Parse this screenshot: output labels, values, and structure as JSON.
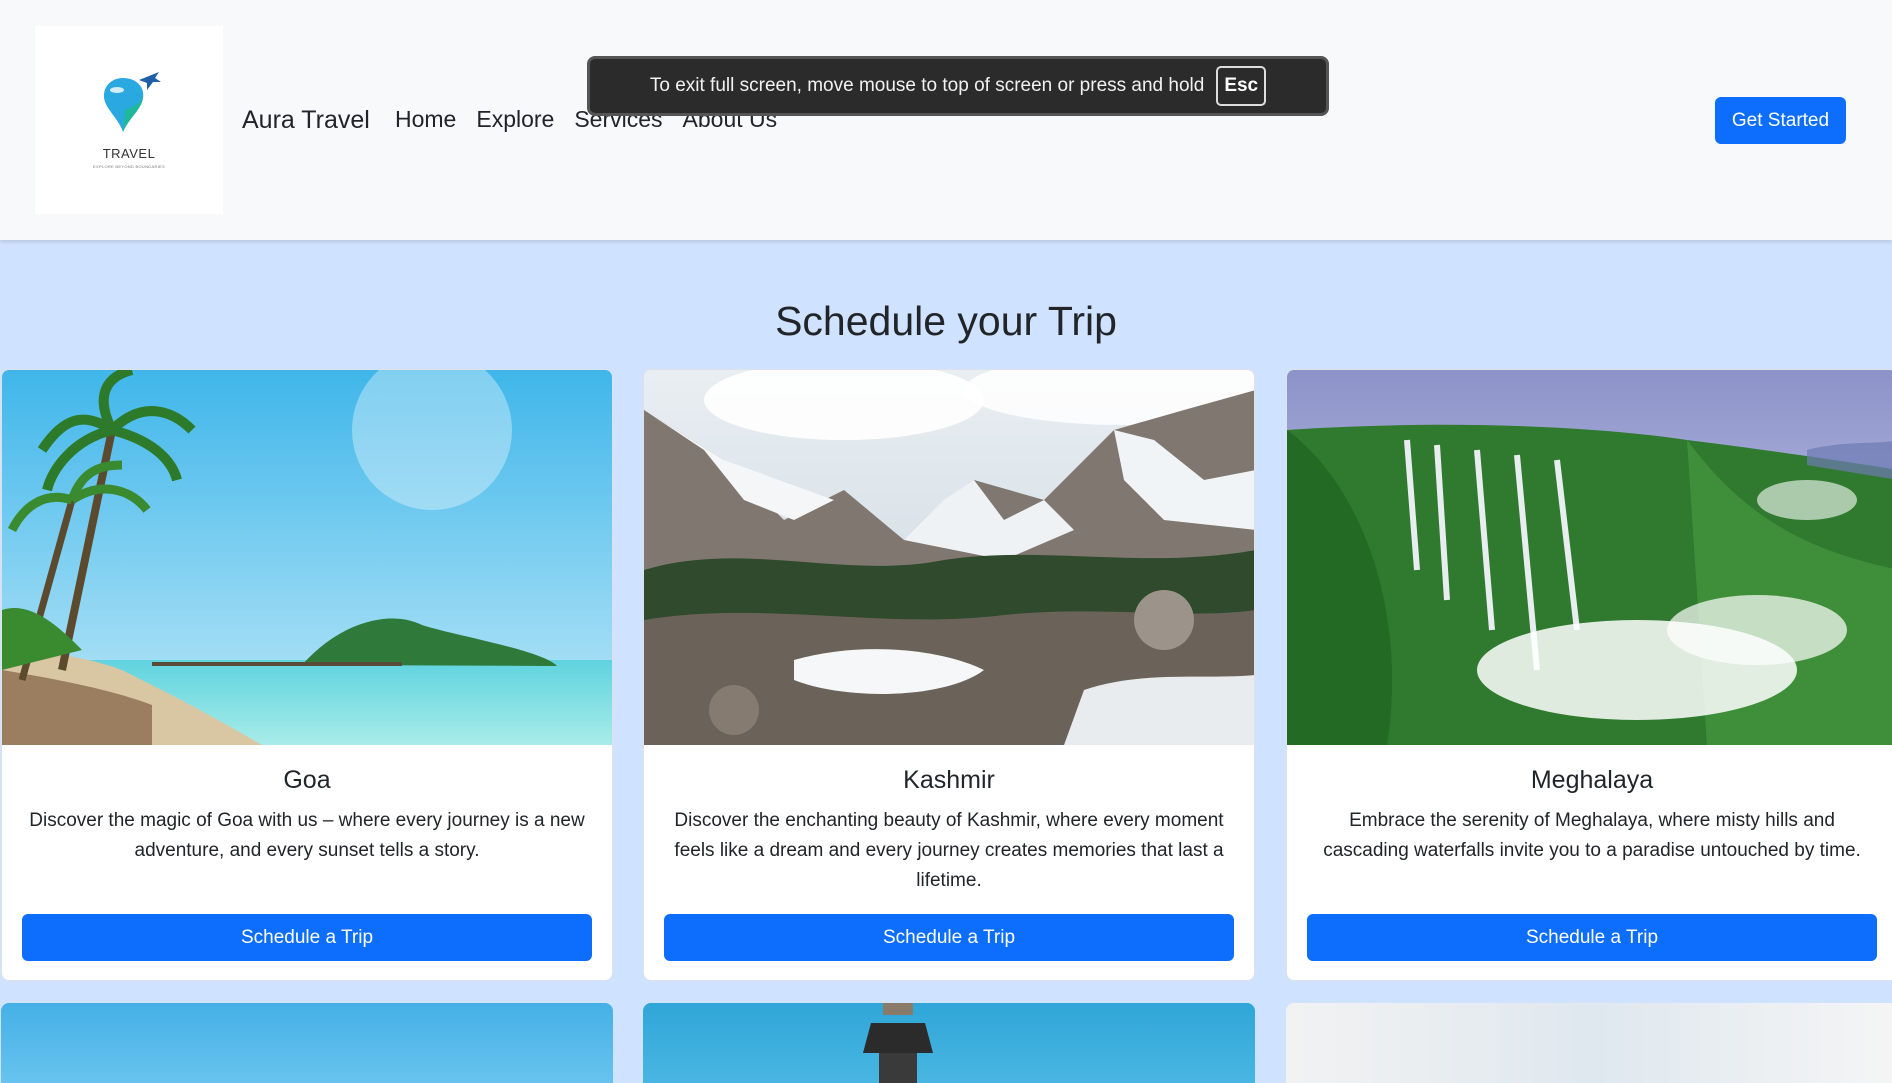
{
  "navbar": {
    "logo": {
      "text": "TRAVEL",
      "tagline": "EXPLORE BEYOND BOUNDARIES"
    },
    "brand": "Aura Travel",
    "links": [
      "Home",
      "Explore",
      "Services",
      "About Us"
    ],
    "cta": "Get Started"
  },
  "fullscreen_toast": {
    "message": "To exit full screen, move mouse to top of screen or press and hold",
    "key": "Esc"
  },
  "section": {
    "title": "Schedule your Trip"
  },
  "cards": [
    {
      "title": "Goa",
      "text": "Discover the magic of Goa with us – where every journey is a new adventure, and every sunset tells a story.",
      "button": "Schedule a Trip"
    },
    {
      "title": "Kashmir",
      "text": "Discover the enchanting beauty of Kashmir, where every moment feels like a dream and every journey creates memories that last a lifetime.",
      "button": "Schedule a Trip"
    },
    {
      "title": "Meghalaya",
      "text": "Embrace the serenity of Meghalaya, where misty hills and cascading waterfalls invite you to a paradise untouched by time.",
      "button": "Schedule a Trip"
    }
  ],
  "colors": {
    "primary": "#0d6efd",
    "page_bg": "#cfe2ff",
    "navbar_bg": "#f8f9fa"
  }
}
